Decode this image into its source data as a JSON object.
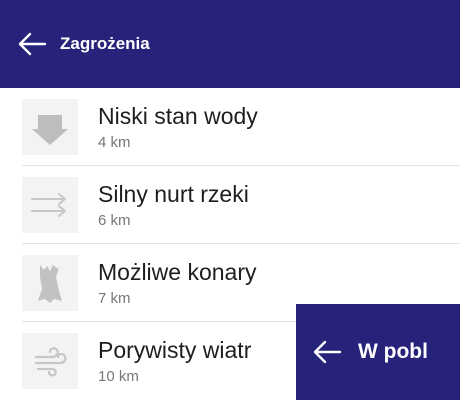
{
  "header": {
    "title": "Zagrożenia",
    "back_icon": "arrow-left-icon",
    "background": "#27237a"
  },
  "hazards": [
    {
      "name": "Niski stan wody",
      "distance": "4 km",
      "icon": "low-water-icon"
    },
    {
      "name": "Silny nurt rzeki",
      "distance": "6 km",
      "icon": "strong-current-icon"
    },
    {
      "name": "Możliwe konary",
      "distance": "7 km",
      "icon": "branches-icon"
    },
    {
      "name": "Porywisty wiatr",
      "distance": "10 km",
      "icon": "wind-icon"
    }
  ],
  "overlay_header": {
    "title": "W pobl",
    "back_icon": "arrow-left-icon"
  }
}
